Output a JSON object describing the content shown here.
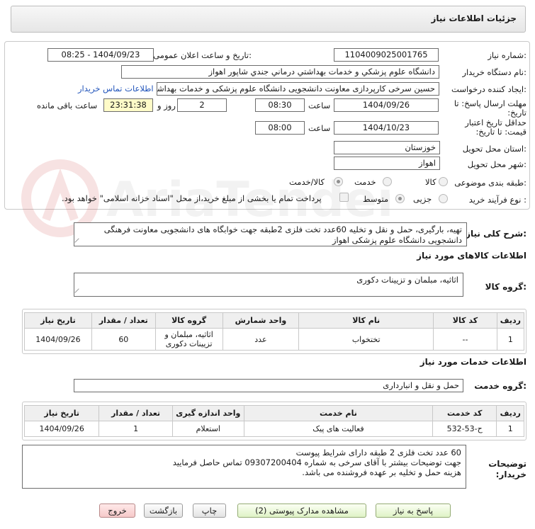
{
  "page": {
    "title": "جزئیات اطلاعات نیاز"
  },
  "info": {
    "need_number_label": "شماره نیاز:",
    "need_number": "1104009025001765",
    "announce_label": "تاریخ و ساعت اعلان عمومی:",
    "announce_value": "1404/09/23 - 08:25",
    "buyer_org_label": "نام دستگاه خریدار:",
    "buyer_org": "دانشگاه علوم پزشكي و خدمات بهداشتي درماني جندي شاپور اهواز",
    "requester_label": "ایجاد کننده درخواست:",
    "requester": "حسین سرخی کارپردازی معاونت دانشجویی دانشگاه علوم پزشکی و خدمات بهداشتی",
    "contact_link": "اطلاعات تماس خریدار",
    "deadline_label": "مهلت ارسال پاسخ: تا تاریخ:",
    "deadline_date": "1404/09/26",
    "time_label": "ساعت",
    "deadline_time": "08:30",
    "days_count": "2",
    "days_label": "روز و",
    "remaining_time": "23:31:38",
    "remaining_label": "ساعت باقی مانده",
    "validity_label": "حداقل تاریخ اعتبار قیمت: تا تاریخ:",
    "validity_date": "1404/10/23",
    "validity_time_label": "ساعت",
    "validity_time": "08:00",
    "province_label": "استان محل تحویل:",
    "province": "خوزستان",
    "city_label": "شهر محل تحویل:",
    "city": "اهواز",
    "category_label": "طبقه بندی موضوعی:",
    "category_options": [
      "کالا",
      "خدمت",
      "کالا/خدمت"
    ],
    "process_label": "نوع فرآیند خرید :",
    "process_options": [
      "جزیی",
      "متوسط"
    ],
    "payment_note": "پرداخت تمام یا بخشی از مبلغ خرید،از محل \"اسناد خزانه اسلامی\" خواهد بود."
  },
  "summary": {
    "label": "شرح کلی نیاز:",
    "text": "تهیه، بارگیری، حمل و نقل و تخلیه 60عدد تخت فلزی 2طبقه جهت خوابگاه های دانشجویی معاونت فرهنگی دانشجویی دانشگاه علوم پزشکی اهواز"
  },
  "goods": {
    "section_title": "اطلاعات کالاهای مورد نیاز",
    "group_label": "گروه کالا:",
    "group_value": "اثاثیه، مبلمان و تزیینات دکوری",
    "headers": [
      "ردیف",
      "کد کالا",
      "نام کالا",
      "واحد شمارش",
      "گروه کالا",
      "تعداد / مقدار",
      "تاریخ نیاز"
    ],
    "rows": [
      [
        "1",
        "--",
        "تختخواب",
        "عدد",
        "اثاثیه، مبلمان و تزیینات دکوری",
        "60",
        "1404/09/26"
      ]
    ]
  },
  "services": {
    "section_title": "اطلاعات خدمات مورد نیاز",
    "group_label": "گروه خدمت:",
    "group_value": "حمل و نقل و انبارداری",
    "headers": [
      "ردیف",
      "کد خدمت",
      "نام خدمت",
      "واحد اندازه گیری",
      "تعداد / مقدار",
      "تاریخ نیاز"
    ],
    "rows": [
      [
        "1",
        "ح-53-532",
        "فعالیت های پیک",
        "استعلام",
        "1",
        "1404/09/26"
      ]
    ]
  },
  "buyer_notes": {
    "label": "توضیحات خریدار:",
    "lines": [
      "60 عدد تخت فلزی 2 طبقه دارای شرایط پیوست",
      "جهت توضیحات بیشتر با آقای سرخی  به شماره 09307200404 تماس حاصل فرمایید",
      "هزینه حمل و تخلیه بر عهده فروشنده می باشد."
    ]
  },
  "buttons": {
    "reply": "پاسخ به نیاز",
    "attachments": "مشاهده مدارک پیوستی (2)",
    "print": "چاپ",
    "back": "بازگشت",
    "exit": "خروج"
  },
  "watermark": {
    "text": "AriaTender.net"
  }
}
